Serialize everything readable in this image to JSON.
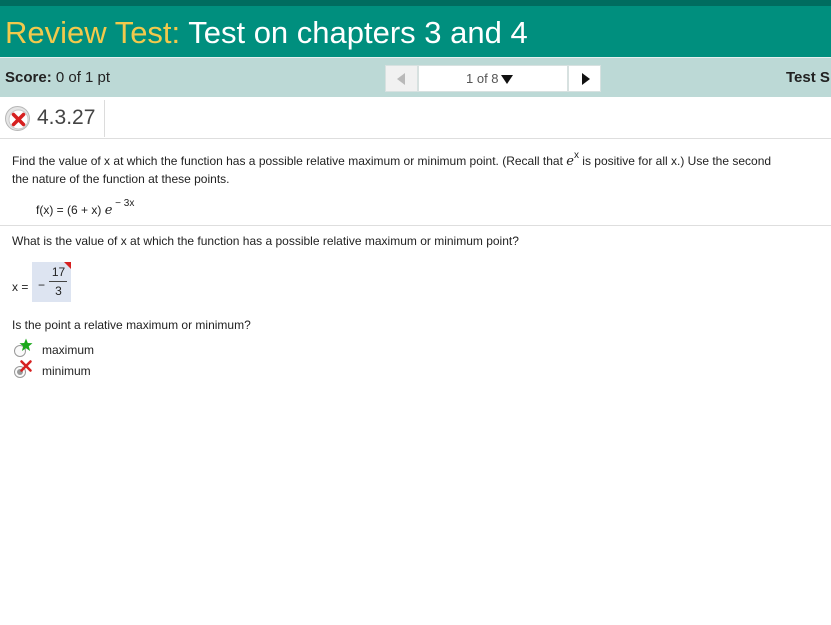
{
  "header": {
    "title_prefix": "Review Test:",
    "title_main": " Test on chapters 3 and 4"
  },
  "scorebar": {
    "score_label": "Score:",
    "score_value": " 0 of 1 pt",
    "pager_text": "1 of 8",
    "test_label": "Test S"
  },
  "question": {
    "status": "incorrect",
    "number": "4.3.27",
    "instruction_part1": "Find the value of x at which the function has a possible relative maximum or minimum point. (Recall that ",
    "instruction_e": "e",
    "instruction_sup": "x",
    "instruction_part2": " is positive for all x.) Use the second",
    "instruction_line2": "the nature of the function at these points.",
    "function_text": "f(x) = (6 + x) ",
    "function_e": "e",
    "function_exp": " − 3x",
    "prompt1": "What is the value of x at which the function has a possible relative maximum or minimum point?",
    "answer_label": "x =",
    "answer_sign": "−",
    "answer_numerator": "17",
    "answer_denominator": "3",
    "prompt2": "Is the point a relative maximum or minimum?",
    "options": [
      {
        "label": "maximum",
        "mark": "correct-star",
        "selected": false
      },
      {
        "label": "minimum",
        "mark": "incorrect-x",
        "selected": true
      }
    ]
  },
  "colors": {
    "header_bg": "#008f7e",
    "title_prefix": "#f2c94c",
    "scorebar_bg": "#bcd9d6",
    "answer_box_bg": "#dde4f1",
    "error_red": "#d62020",
    "correct_green": "#1aa81a"
  }
}
